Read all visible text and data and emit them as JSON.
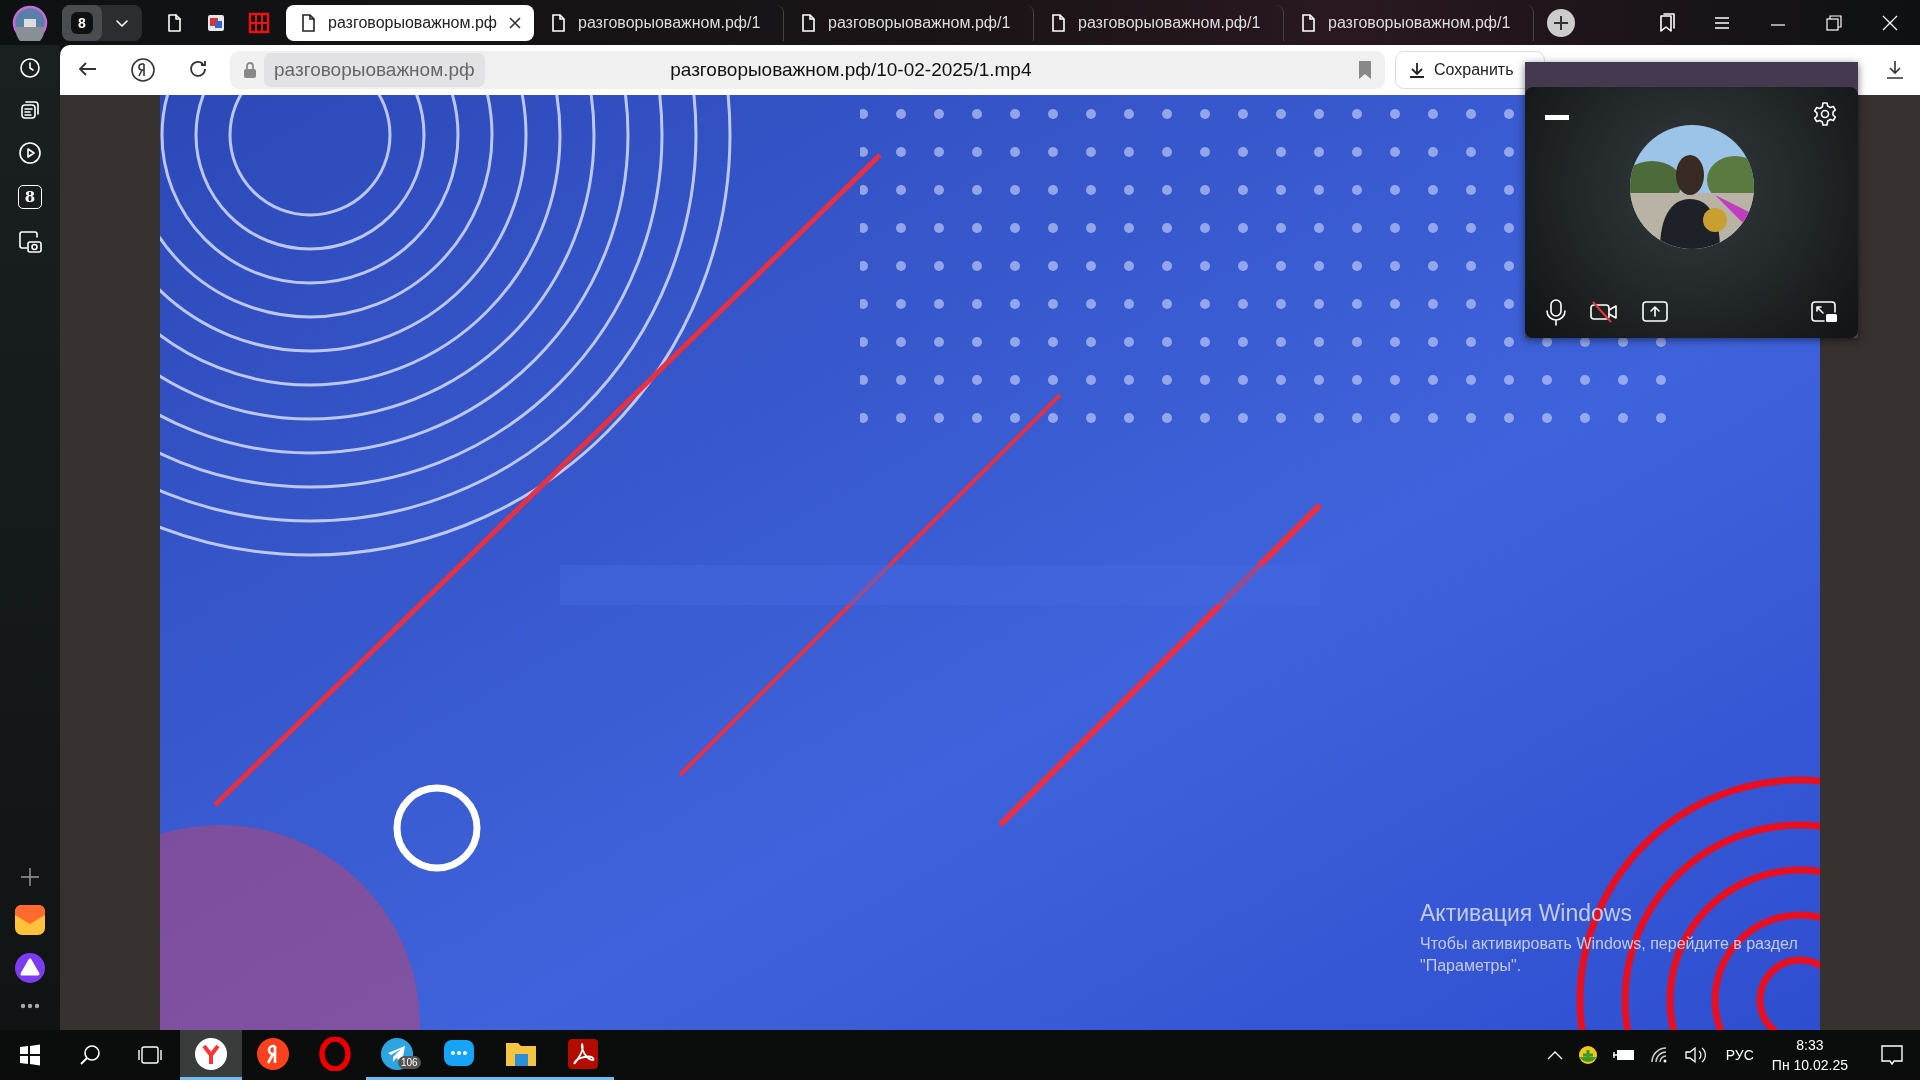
{
  "tab_bar": {
    "group_count": "8",
    "pinned_tabs": [
      {
        "kind": "page"
      },
      {
        "kind": "app"
      },
      {
        "kind": "red-logo"
      }
    ],
    "tabs": [
      {
        "title": "разговорыоважном.рф",
        "selected": true
      },
      {
        "title": "разговорыоважном.рф/1",
        "selected": false
      },
      {
        "title": "разговорыоважном.рф/1",
        "selected": false
      },
      {
        "title": "разговорыоважном.рф/1",
        "selected": false
      },
      {
        "title": "разговорыоважном.рф/1",
        "selected": false
      }
    ]
  },
  "sidebar": {
    "items": [
      {
        "kind": "clock"
      },
      {
        "kind": "collections"
      },
      {
        "kind": "play"
      },
      {
        "kind": "count",
        "label": "8"
      },
      {
        "kind": "screenshot"
      }
    ],
    "bottom_items": [
      {
        "kind": "plus"
      },
      {
        "kind": "mail"
      },
      {
        "kind": "alice"
      },
      {
        "kind": "more"
      }
    ]
  },
  "toolbar": {
    "site": "разговорыоважном.рф",
    "url": "разговорыоважном.рф/10-02-2025/1.mp4",
    "save_button": "Сохранить"
  },
  "call_widget": {
    "camera_off": true
  },
  "activation_notice": {
    "title": "Активация Windows",
    "text": "Чтобы активировать Windows, перейдите в раздел \"Параметры\"."
  },
  "taskbar": {
    "apps": [
      {
        "kind": "yandex-browser",
        "selected": true,
        "running": true
      },
      {
        "kind": "yandex",
        "selected": false,
        "running": false
      },
      {
        "kind": "opera",
        "selected": false,
        "running": false
      },
      {
        "kind": "telegram",
        "selected": false,
        "running": true,
        "badge": "106"
      },
      {
        "kind": "messenger",
        "selected": false,
        "running": true
      },
      {
        "kind": "explorer",
        "selected": false,
        "running": true
      },
      {
        "kind": "acrobat",
        "selected": false,
        "running": true
      }
    ],
    "language": "РУС",
    "time": "8:33",
    "date": "Пн 10.02.25"
  }
}
